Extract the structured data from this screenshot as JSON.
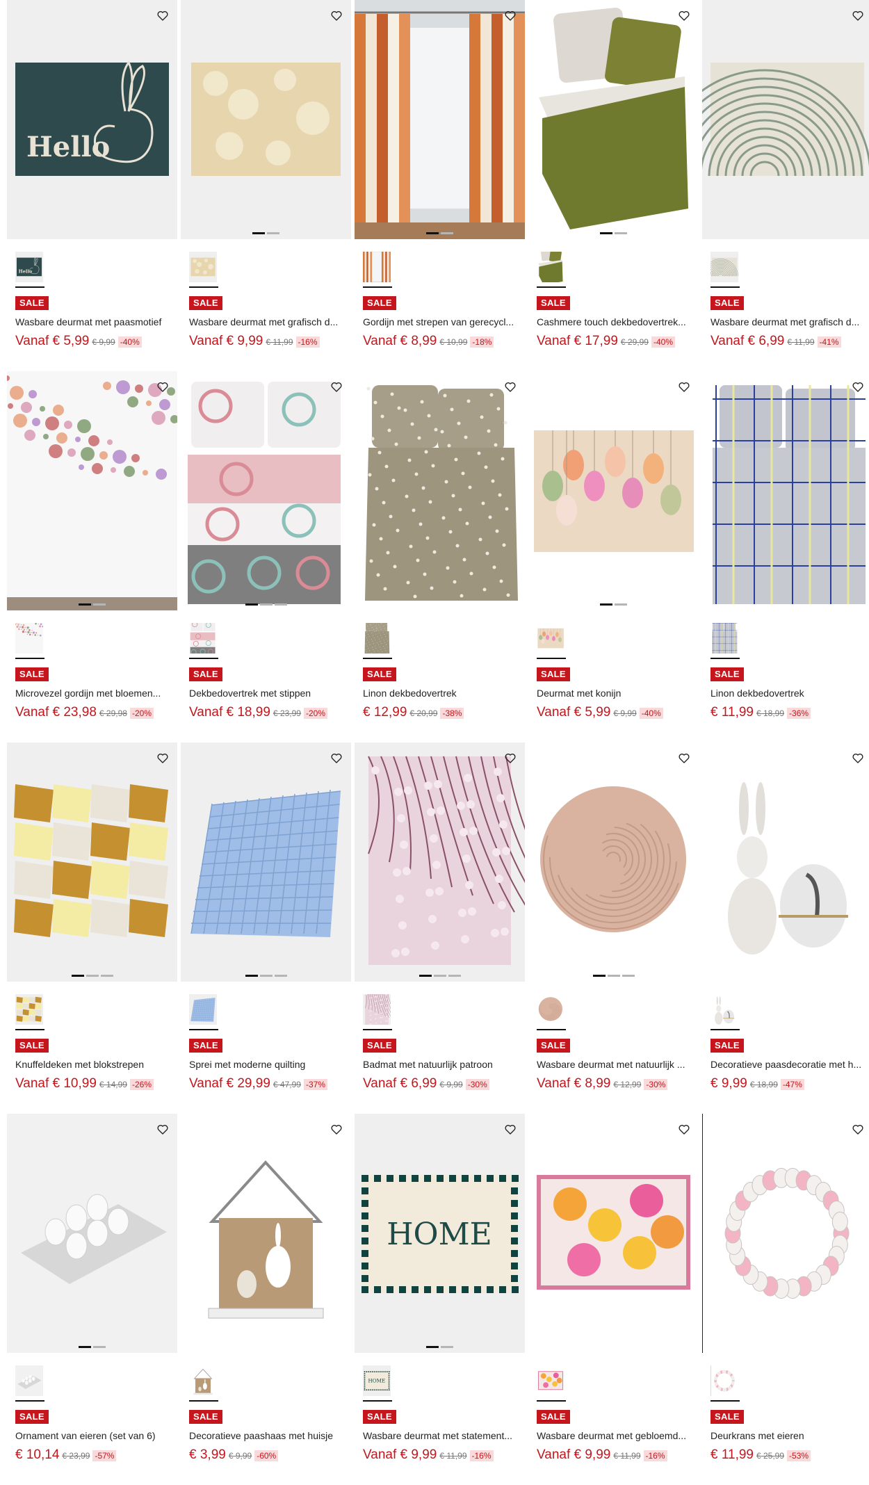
{
  "labels": {
    "sale": "SALE"
  },
  "products": [
    {
      "title": "Wasbare deurmat met paasmotief",
      "price": "Vanaf € 5,99",
      "old": "€ 9,99",
      "disc": "-40%",
      "art": "door-mat-bunny",
      "dots": 0
    },
    {
      "title": "Wasbare deurmat met grafisch d...",
      "price": "Vanaf € 9,99",
      "old": "€ 11,99",
      "disc": "-16%",
      "art": "beige-mat",
      "dots": 2
    },
    {
      "title": "Gordijn met strepen van gerecycl...",
      "price": "Vanaf € 8,99",
      "old": "€ 10,99",
      "disc": "-18%",
      "art": "striped-curtain",
      "dots": 2
    },
    {
      "title": "Cashmere touch dekbedovertrek...",
      "price": "Vanaf € 17,99",
      "old": "€ 29,99",
      "disc": "-40%",
      "art": "olive-bedding",
      "dots": 2
    },
    {
      "title": "Wasbare deurmat met grafisch d...",
      "price": "Vanaf € 6,99",
      "old": "€ 11,99",
      "disc": "-41%",
      "art": "swirl-mat",
      "dots": 0
    },
    {
      "title": "Microvezel gordijn met bloemen...",
      "price": "Vanaf € 23,98",
      "old": "€ 29,98",
      "disc": "-20%",
      "art": "floral-curtain",
      "dots": 2
    },
    {
      "title": "Dekbedovertrek met stippen",
      "price": "Vanaf € 18,99",
      "old": "€ 23,99",
      "disc": "-20%",
      "art": "circle-bedding",
      "dots": 3
    },
    {
      "title": "Linon dekbedovertrek",
      "price": "€ 12,99",
      "old": "€ 20,99",
      "disc": "-38%",
      "art": "leaf-bedding",
      "dots": 0
    },
    {
      "title": "Deurmat met konijn",
      "price": "Vanaf € 5,99",
      "old": "€ 9,99",
      "disc": "-40%",
      "art": "easter-egg-mat",
      "dots": 2
    },
    {
      "title": "Linon dekbedovertrek",
      "price": "€ 11,99",
      "old": "€ 18,99",
      "disc": "-36%",
      "art": "check-bedding",
      "dots": 0
    },
    {
      "title": "Knuffeldeken met blokstrepen",
      "price": "Vanaf € 10,99",
      "old": "€ 14,99",
      "disc": "-26%",
      "art": "patchwork-blanket",
      "dots": 3
    },
    {
      "title": "Sprei met moderne quilting",
      "price": "Vanaf € 29,99",
      "old": "€ 47,99",
      "disc": "-37%",
      "art": "blue-quilt",
      "dots": 3
    },
    {
      "title": "Badmat met natuurlijk patroon",
      "price": "Vanaf € 6,99",
      "old": "€ 9,99",
      "disc": "-30%",
      "art": "pink-branch-mat",
      "dots": 3
    },
    {
      "title": "Wasbare deurmat met natuurlijk ...",
      "price": "Vanaf € 8,99",
      "old": "€ 12,99",
      "disc": "-30%",
      "art": "round-mat",
      "dots": 3
    },
    {
      "title": "Decoratieve paasdecoratie met h...",
      "price": "€ 9,99",
      "old": "€ 18,99",
      "disc": "-47%",
      "art": "bunny-egg-deco",
      "dots": 0
    },
    {
      "title": "Ornament van eieren (set van 6)",
      "price": "€ 10,14",
      "old": "€ 23,99",
      "disc": "-57%",
      "art": "egg-tray",
      "dots": 2
    },
    {
      "title": "Decoratieve paashaas met huisje",
      "price": "€ 3,99",
      "old": "€ 9,99",
      "disc": "-60%",
      "art": "bunny-house",
      "dots": 0
    },
    {
      "title": "Wasbare deurmat met statement...",
      "price": "Vanaf € 9,99",
      "old": "€ 11,99",
      "disc": "-16%",
      "art": "home-mat",
      "dots": 2
    },
    {
      "title": "Wasbare deurmat met gebloemd...",
      "price": "Vanaf € 9,99",
      "old": "€ 11,99",
      "disc": "-16%",
      "art": "flower-mat",
      "dots": 0
    },
    {
      "title": "Deurkrans met eieren",
      "price": "€ 11,99",
      "old": "€ 25,99",
      "disc": "-53%",
      "art": "egg-wreath",
      "dots": 0
    }
  ],
  "art_text": {
    "hello": "Hello",
    "home": "HOME"
  }
}
